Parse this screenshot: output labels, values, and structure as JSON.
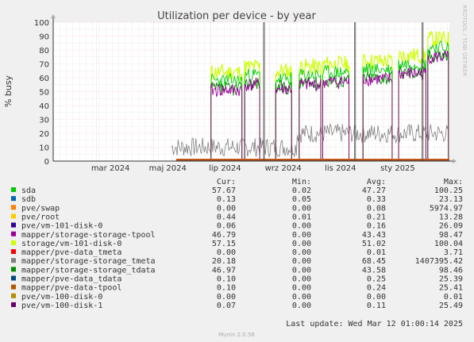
{
  "chart_data": {
    "type": "line",
    "title": "Utilization per device - by year",
    "ylabel": "% busy",
    "side_label": "RRDTOOL / TOBI OETIKER",
    "ylim": [
      0,
      100
    ],
    "yticks": [
      0,
      10,
      20,
      30,
      40,
      50,
      60,
      70,
      80,
      90,
      100
    ],
    "xlim": [
      "2024-01-15",
      "2025-03-12"
    ],
    "xticks": [
      {
        "date": "2024-03-01",
        "label": "mar 2024"
      },
      {
        "date": "2024-05-01",
        "label": "maj 2024"
      },
      {
        "date": "2024-07-01",
        "label": "lip 2024"
      },
      {
        "date": "2024-09-01",
        "label": "wrz 2024"
      },
      {
        "date": "2024-11-01",
        "label": "lis 2024"
      },
      {
        "date": "2025-01-01",
        "label": "sty 2025"
      }
    ],
    "grid": true,
    "legend_headers": {
      "cur": "Cur:",
      "min": "Min:",
      "avg": "Avg:",
      "max": "Max:"
    },
    "series": [
      {
        "name": "sda",
        "color": "#00cc00",
        "cur": "57.67",
        "min": "0.02",
        "avg": "47.27",
        "max": "100.25"
      },
      {
        "name": "sdb",
        "color": "#0066b3",
        "cur": "0.13",
        "min": "0.05",
        "avg": "0.33",
        "max": "23.13"
      },
      {
        "name": "pve/swap",
        "color": "#ff8000",
        "cur": "0.00",
        "min": "0.00",
        "avg": "0.08",
        "max": "5974.97"
      },
      {
        "name": "pve/root",
        "color": "#ffcc00",
        "cur": "0.44",
        "min": "0.01",
        "avg": "0.21",
        "max": "13.28"
      },
      {
        "name": "pve/vm-101-disk-0",
        "color": "#330099",
        "cur": "0.06",
        "min": "0.00",
        "avg": "0.16",
        "max": "26.09"
      },
      {
        "name": "mapper/storage-storage-tpool",
        "color": "#990099",
        "cur": "46.79",
        "min": "0.00",
        "avg": "43.43",
        "max": "98.47"
      },
      {
        "name": "storage/vm-101-disk-0",
        "color": "#ccff00",
        "cur": "57.15",
        "min": "0.00",
        "avg": "51.02",
        "max": "100.04"
      },
      {
        "name": "mapper/pve-data_tmeta",
        "color": "#ff0000",
        "cur": "0.00",
        "min": "0.00",
        "avg": "0.01",
        "max": "3.71"
      },
      {
        "name": "mapper/storage-storage_tmeta",
        "color": "#808080",
        "cur": "20.18",
        "min": "0.00",
        "avg": "68.45",
        "max": "1407395.42"
      },
      {
        "name": "mapper/storage-storage_tdata",
        "color": "#008f00",
        "cur": "46.97",
        "min": "0.00",
        "avg": "43.58",
        "max": "98.46"
      },
      {
        "name": "mapper/pve-data_tdata",
        "color": "#00487d",
        "cur": "0.10",
        "min": "0.00",
        "avg": "0.25",
        "max": "25.39"
      },
      {
        "name": "mapper/pve-data-tpool",
        "color": "#b35a00",
        "cur": "0.10",
        "min": "0.00",
        "avg": "0.24",
        "max": "25.41"
      },
      {
        "name": "pve/vm-100-disk-0",
        "color": "#b38f00",
        "cur": "0.00",
        "min": "0.00",
        "avg": "0.00",
        "max": "0.01"
      },
      {
        "name": "pve/vm-100-disk-1",
        "color": "#6b006b",
        "cur": "0.07",
        "min": "0.00",
        "avg": "0.11",
        "max": "25.49"
      }
    ],
    "last_update": "Last update: Wed Mar 12 01:00:14 2025",
    "footer": "Munin 2.0.56"
  }
}
